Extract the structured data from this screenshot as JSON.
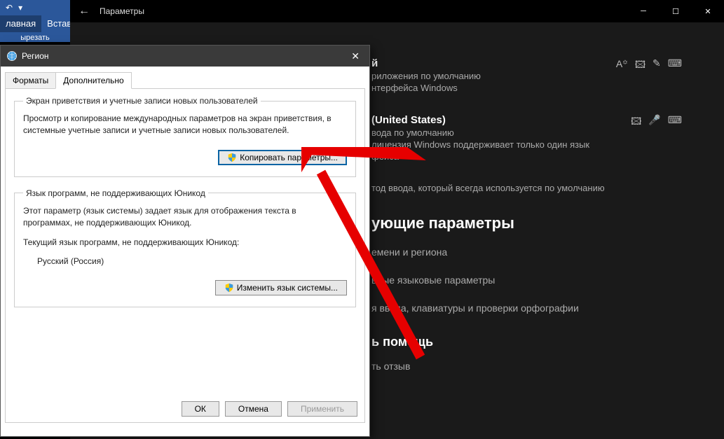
{
  "word": {
    "tab_home": "лавная",
    "tab_insert": "Встав",
    "group_cut": "ырезать"
  },
  "settings": {
    "title": "Параметры",
    "lang1": {
      "name_suffix": "й",
      "line1": "риложения по умолчанию",
      "line2": "нтерфейса Windows"
    },
    "lang2": {
      "name": "(United States)",
      "line1": "вода по умолчанию",
      "line2": "лицензия Windows поддерживает только один язык",
      "line3": "фейса"
    },
    "default_input": "тод ввода, который всегда используется по умолчанию",
    "related_heading": "ующие параметры",
    "related1": "емени и региона",
    "related2": "вные языковые параметры",
    "related3": "я ввода, клавиатуры и проверки орфографии",
    "help_heading": "ь помощь",
    "help1": "ть отзыв"
  },
  "region": {
    "title": "Регион",
    "tab_formats": "Форматы",
    "tab_advanced": "Дополнительно",
    "group1_legend": "Экран приветствия и учетные записи новых пользователей",
    "group1_text": "Просмотр и копирование международных параметров на экран приветствия, в системные учетные записи и учетные записи новых пользователей.",
    "copy_params_btn": "Копировать параметры...",
    "group2_legend": "Язык программ, не поддерживающих Юникод",
    "group2_text": "Этот параметр (язык системы) задает язык для отображения текста в программах, не поддерживающих Юникод.",
    "group2_current_label": "Текущий язык программ, не поддерживающих Юникод:",
    "group2_current_value": "Русский (Россия)",
    "change_lang_btn": "Изменить язык системы...",
    "ok": "ОК",
    "cancel": "Отмена",
    "apply": "Применить"
  }
}
